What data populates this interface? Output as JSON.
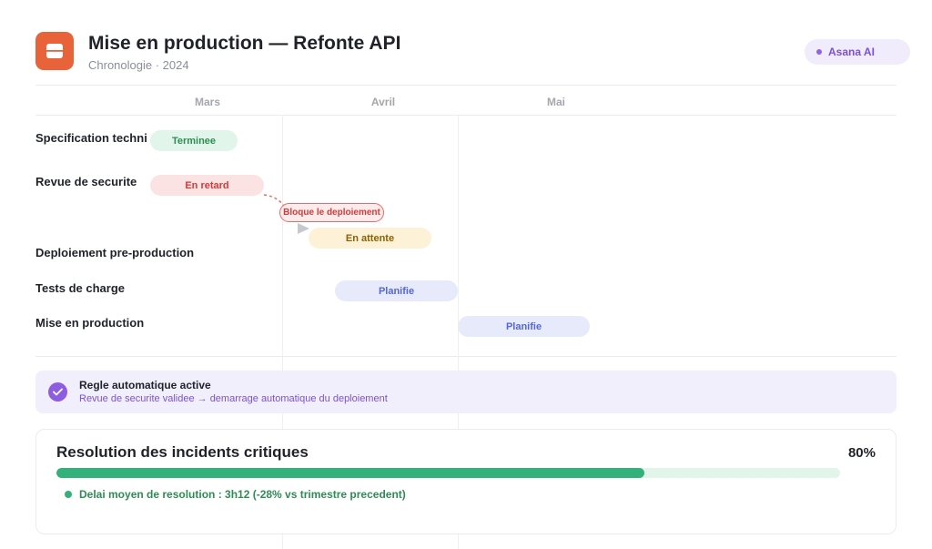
{
  "header": {
    "title": "Mise en production — Refonte API",
    "subtitle": "Chronologie · 2024",
    "app_icon": "project-card-icon",
    "ai_badge_label": "Asana AI"
  },
  "timeline": {
    "months": [
      "Mars",
      "Avril",
      "Mai"
    ],
    "tasks": [
      {
        "label": "Specification techni",
        "status": "Terminee",
        "status_color": "green"
      },
      {
        "label": "Revue de securite",
        "status": "En retard",
        "status_color": "red"
      },
      {
        "label": "Deploiement pre-production",
        "status": "En attente",
        "status_color": "yellow"
      },
      {
        "label": "Tests de charge",
        "status": "Planifie",
        "status_color": "blue"
      },
      {
        "label": "Mise en production",
        "status": "Planifie",
        "status_color": "blue"
      }
    ],
    "dependency_label": "Bloque le deploiement"
  },
  "rule": {
    "title": "Regle automatique active",
    "description": "Revue de securite validee → demarrage automatique du deploiement",
    "icon": "check-circle-icon"
  },
  "metric": {
    "title": "Resolution des incidents critiques",
    "percent_label": "80%",
    "progress_value": 0.8,
    "note": "Delai moyen de resolution : 3h12 (-28% vs trimestre precedent)"
  },
  "colors": {
    "accent": "#e8623a",
    "ai_purple": "#7c4fd8",
    "success": "#34b07b",
    "danger": "#d23b3b",
    "warning": "#8a6200",
    "info": "#5566d6"
  }
}
